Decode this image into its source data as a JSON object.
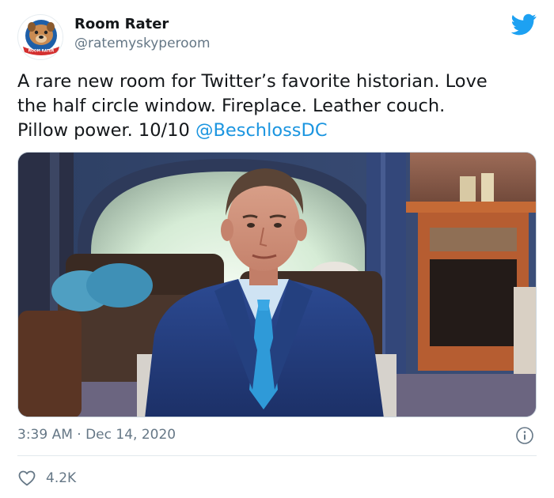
{
  "author": {
    "display_name": "Room Rater",
    "handle": "@ratemyskyperoom",
    "avatar_icon": "bulldog-logo-icon",
    "avatar_badge_text": "ROOM RATER"
  },
  "tweet": {
    "text_line1": "A rare new room for Twitter’s favorite historian. Love",
    "text_line2": "the half circle window. Fireplace. Leather couch.",
    "text_line3_prefix": "Pillow power. 10/10 ",
    "mention": "@BeschlossDC",
    "timestamp": "3:39 AM · Dec 14, 2020"
  },
  "engagement": {
    "like_icon": "heart-icon",
    "likes": "4.2K"
  },
  "colors": {
    "twitter_blue": "#1da1f2",
    "link": "#1b95e0",
    "secondary_text": "#657786"
  }
}
